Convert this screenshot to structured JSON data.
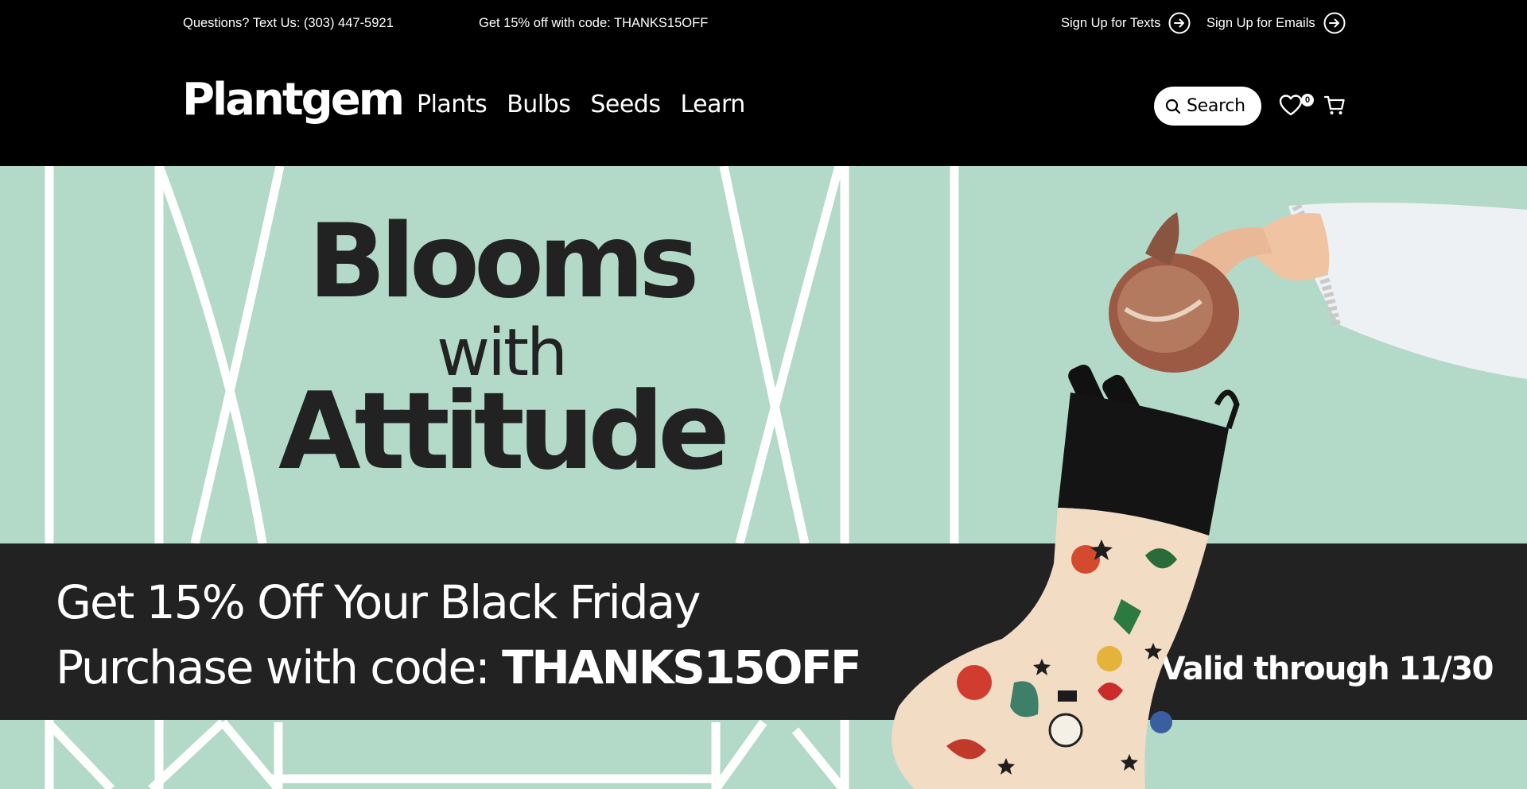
{
  "topbar": {
    "phone": "Questions? Text Us: (303) 447-5921",
    "promo": "Get 15% off with code: THANKS15OFF",
    "texts_link": "Sign Up for Texts",
    "emails_link": "Sign Up for Emails"
  },
  "header": {
    "logo": "Plantgem",
    "nav": [
      "Plants",
      "Bulbs",
      "Seeds",
      "Learn"
    ],
    "search_label": "Search",
    "wishlist_count": "0"
  },
  "hero": {
    "line1": "Blooms",
    "line2": "with",
    "line3": "Attitude",
    "promo_line1": "Get 15% Off Your Black Friday",
    "promo_line2_prefix": "Purchase with code: ",
    "promo_code": "THANKS15OFF",
    "valid": "Valid through 11/30"
  },
  "colors": {
    "hero_bg": "#b3d9c8",
    "band_bg": "#222222",
    "header_bg": "#000000"
  }
}
